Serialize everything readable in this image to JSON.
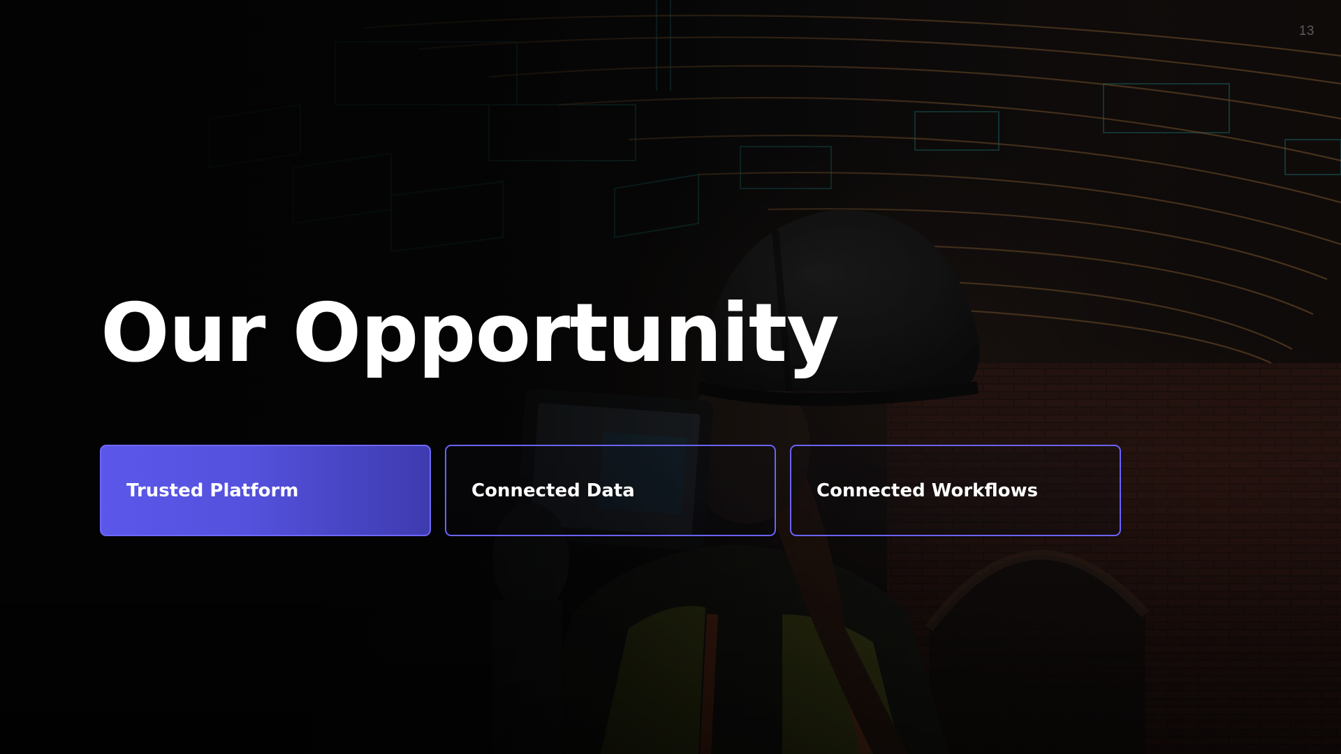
{
  "slide": {
    "page_number": "13",
    "title": "Our Opportunity",
    "cards": [
      {
        "label": "Trusted Platform",
        "state": "active"
      },
      {
        "label": "Connected Data",
        "state": "inactive"
      },
      {
        "label": "Connected Workflows",
        "state": "inactive"
      }
    ],
    "colors": {
      "accent": "#5b57ea",
      "card_border": "#6b63ff",
      "title": "#ffffff",
      "page_number": "#5b5b5e"
    },
    "background": {
      "icon": "construction-worker-photo"
    }
  }
}
